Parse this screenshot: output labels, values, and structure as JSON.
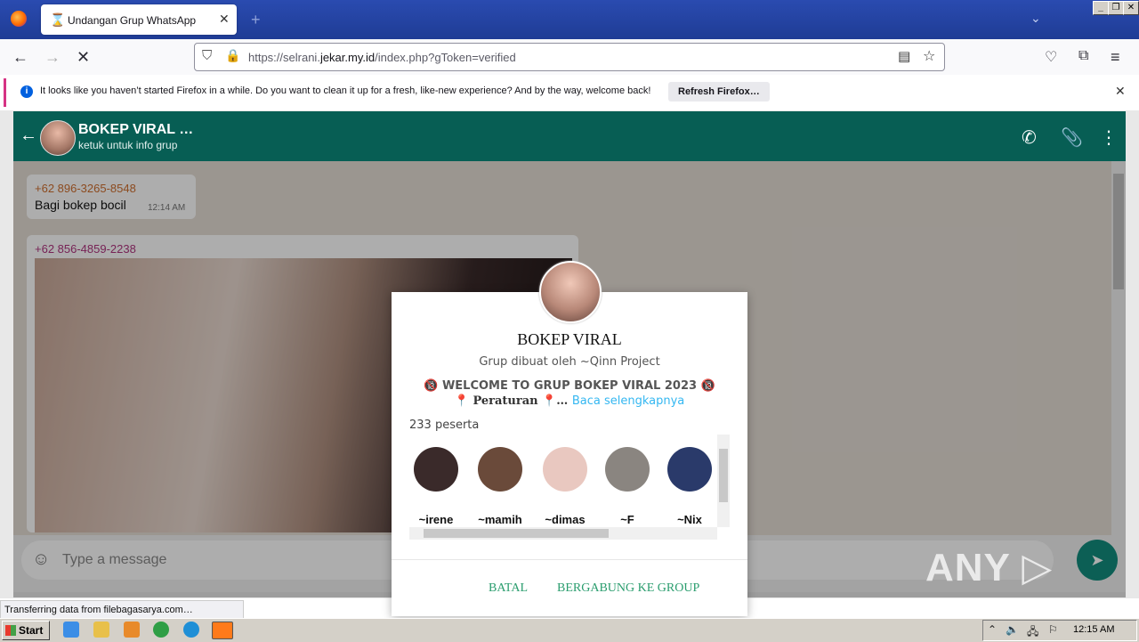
{
  "browser": {
    "tab_title": "Undangan Grup WhatsApp",
    "url_prefix": "https://selrani.",
    "url_domain": "jekar.my.id",
    "url_suffix": "/index.php?gToken=verified",
    "notification": "It looks like you haven’t started Firefox in a while. Do you want to clean it up for a fresh, like-new experience? And by the way, welcome back!",
    "refresh_button": "Refresh Firefox…",
    "status_text": "Transferring data from filebagasarya.com…"
  },
  "chat": {
    "title": "BOKEP VIRAL …",
    "subtitle": "ketuk untuk info grup",
    "messages": [
      {
        "sender": "+62 896-3265-8548",
        "text": "Bagi bokep bocil",
        "time": "12:14 AM"
      },
      {
        "sender": "+62 856-4859-2238"
      }
    ],
    "input_placeholder": "Type a message"
  },
  "modal": {
    "group_name": "BOKEP VIRAL",
    "created_by": "Grup dibuat oleh ~Qinn Project",
    "welcome": "🔞 WELCOME TO GRUP BOKEP VIRAL 2023 🔞",
    "rules_prefix": "📍 Peraturan 📍…",
    "read_more": "Baca selengkapnya",
    "members_count": "233 peserta",
    "members": [
      {
        "name": "~irene",
        "color": "#3a2a2a"
      },
      {
        "name": "~mamih",
        "color": "#6a4a3a"
      },
      {
        "name": "~dimas",
        "color": "#e9c8c0"
      },
      {
        "name": "~F",
        "color": "#8a8580"
      },
      {
        "name": "~Nix",
        "color": "#2a3a6a"
      }
    ],
    "cancel_label": "BATAL",
    "join_label": "BERGABUNG KE GROUP"
  },
  "watermark": "ANY RUN",
  "taskbar": {
    "start_label": "Start",
    "clock": "12:15 AM"
  }
}
